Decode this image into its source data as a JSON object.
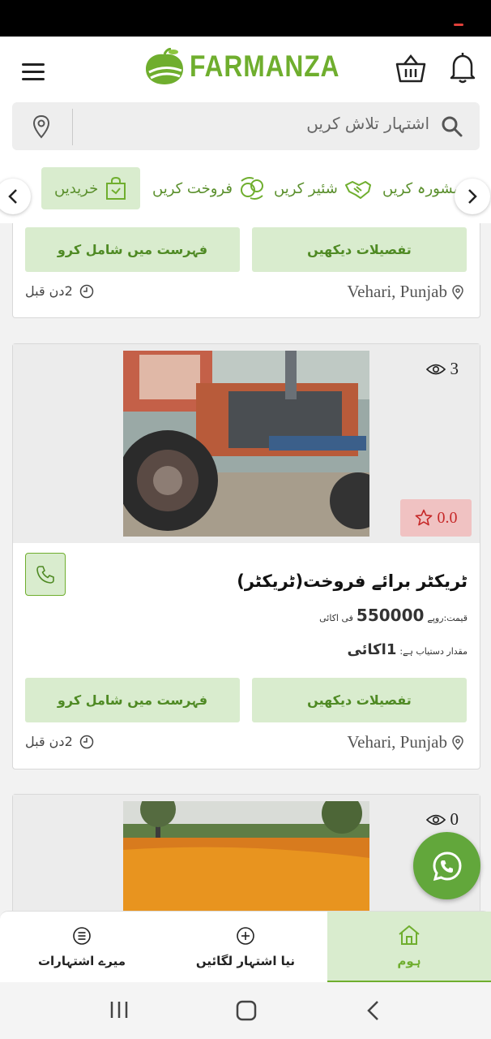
{
  "app": {
    "name": "FARMANZA",
    "brand_color": "#6fae2e"
  },
  "search": {
    "placeholder": "اشتہار تلاش کریں"
  },
  "categories": [
    {
      "label": "مشورہ کریں",
      "icon": "chat-icon"
    },
    {
      "label": "شئیر کریں",
      "icon": "handshake-icon"
    },
    {
      "label": "فروخت کریں",
      "icon": "money-exchange-icon"
    },
    {
      "label": "خریدیں",
      "icon": "shopping-bag-icon",
      "active": true
    }
  ],
  "cards": [
    {
      "details_label": "تفصیلات دیکھیں",
      "add_list_label": "فہرست میں شامل کرو",
      "location": "Vehari, Punjab",
      "time": "2دن قبل"
    },
    {
      "views": "3",
      "rating": "0.0",
      "title": "ٹریکٹر برائے فروخت(ٹریکٹر)",
      "price_prefix": "قیمت:روپے",
      "price": "550000",
      "price_suffix": "فی اکائی",
      "qty_prefix": "مقدار دستیاب ہے:",
      "qty": "1اکائی",
      "details_label": "تفصیلات دیکھیں",
      "add_list_label": "فہرست میں شامل کرو",
      "location": "Vehari, Punjab",
      "time": "2دن قبل"
    },
    {
      "views": "0"
    }
  ],
  "bottom_nav": [
    {
      "label": "میرے اشتہارات",
      "icon": "list-icon"
    },
    {
      "label": "نیا اشتہار لگائیں",
      "icon": "plus-circle-icon"
    },
    {
      "label": "ہوم",
      "icon": "home-icon",
      "active": true
    }
  ]
}
